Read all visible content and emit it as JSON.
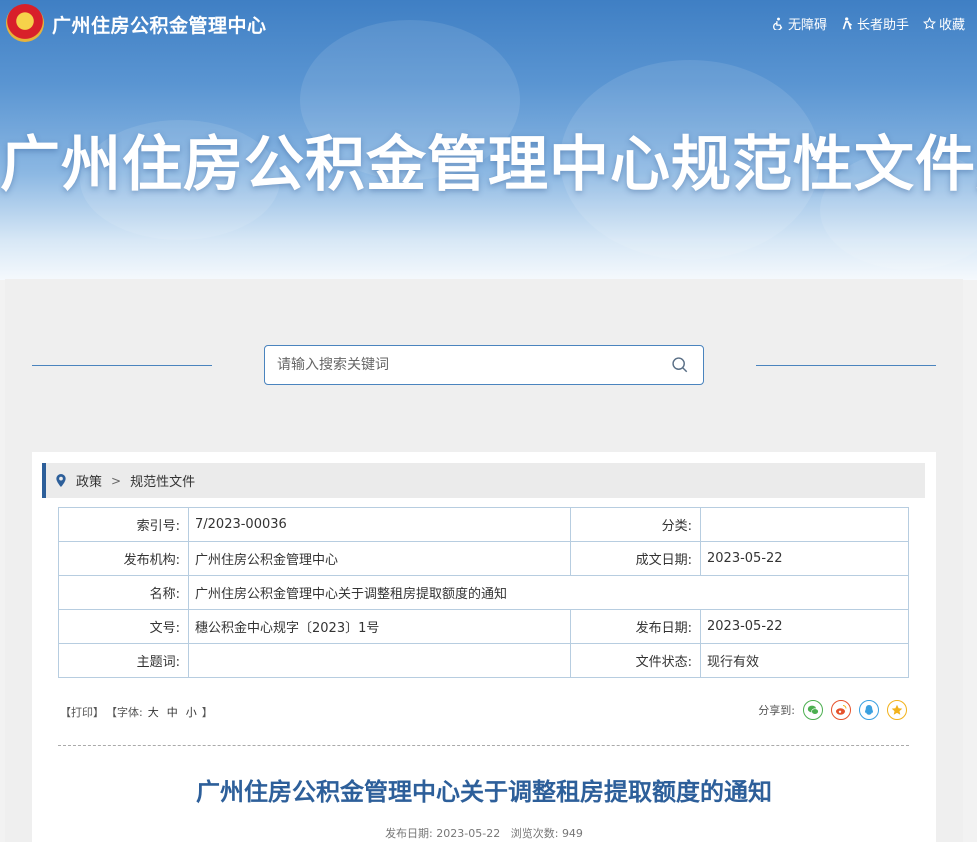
{
  "header": {
    "site_name": "广州住房公积金管理中心",
    "tools": [
      {
        "icon": "accessibility-icon",
        "label": "无障碍"
      },
      {
        "icon": "elder-assist-icon",
        "label": "长者助手"
      },
      {
        "icon": "star-icon",
        "label": "收藏"
      }
    ],
    "banner_title": "广州住房公积金管理中心规范性文件库"
  },
  "search": {
    "placeholder": "请输入搜索关键词",
    "value": ""
  },
  "breadcrumb": {
    "items": [
      "政策",
      "规范性文件"
    ]
  },
  "info": {
    "index_label": "索引号:",
    "index_value": "7/2023-00036",
    "category_label": "分类:",
    "category_value": "",
    "issuer_label": "发布机构:",
    "issuer_value": "广州住房公积金管理中心",
    "created_label": "成文日期:",
    "created_value": "2023-05-22",
    "name_label": "名称:",
    "name_value": "广州住房公积金管理中心关于调整租房提取额度的通知",
    "doc_no_label": "文号:",
    "doc_no_value": "穗公积金中心规字〔2023〕1号",
    "published_label": "发布日期:",
    "published_value": "2023-05-22",
    "keywords_label": "主题词:",
    "keywords_value": "",
    "status_label": "文件状态:",
    "status_value": "现行有效"
  },
  "options": {
    "print": "【打印】",
    "font_prefix": "【字体:",
    "font_large": "大",
    "font_medium": "中",
    "font_small": "小",
    "font_suffix": "】"
  },
  "share": {
    "label": "分享到:",
    "targets": [
      "wechat-icon",
      "weibo-icon",
      "qq-icon",
      "qzone-icon"
    ]
  },
  "article": {
    "title": "广州住房公积金管理中心关于调整租房提取额度的通知",
    "date_label": "发布日期:",
    "date": "2023-05-22",
    "views_label": "浏览次数:",
    "views": "949"
  },
  "colors": {
    "accent": "#2d5f9a",
    "border": "#b7cde0",
    "wechat": "#4caf50",
    "weibo": "#e6522c",
    "qq": "#3aa0e0",
    "qzone": "#f2b21b"
  }
}
